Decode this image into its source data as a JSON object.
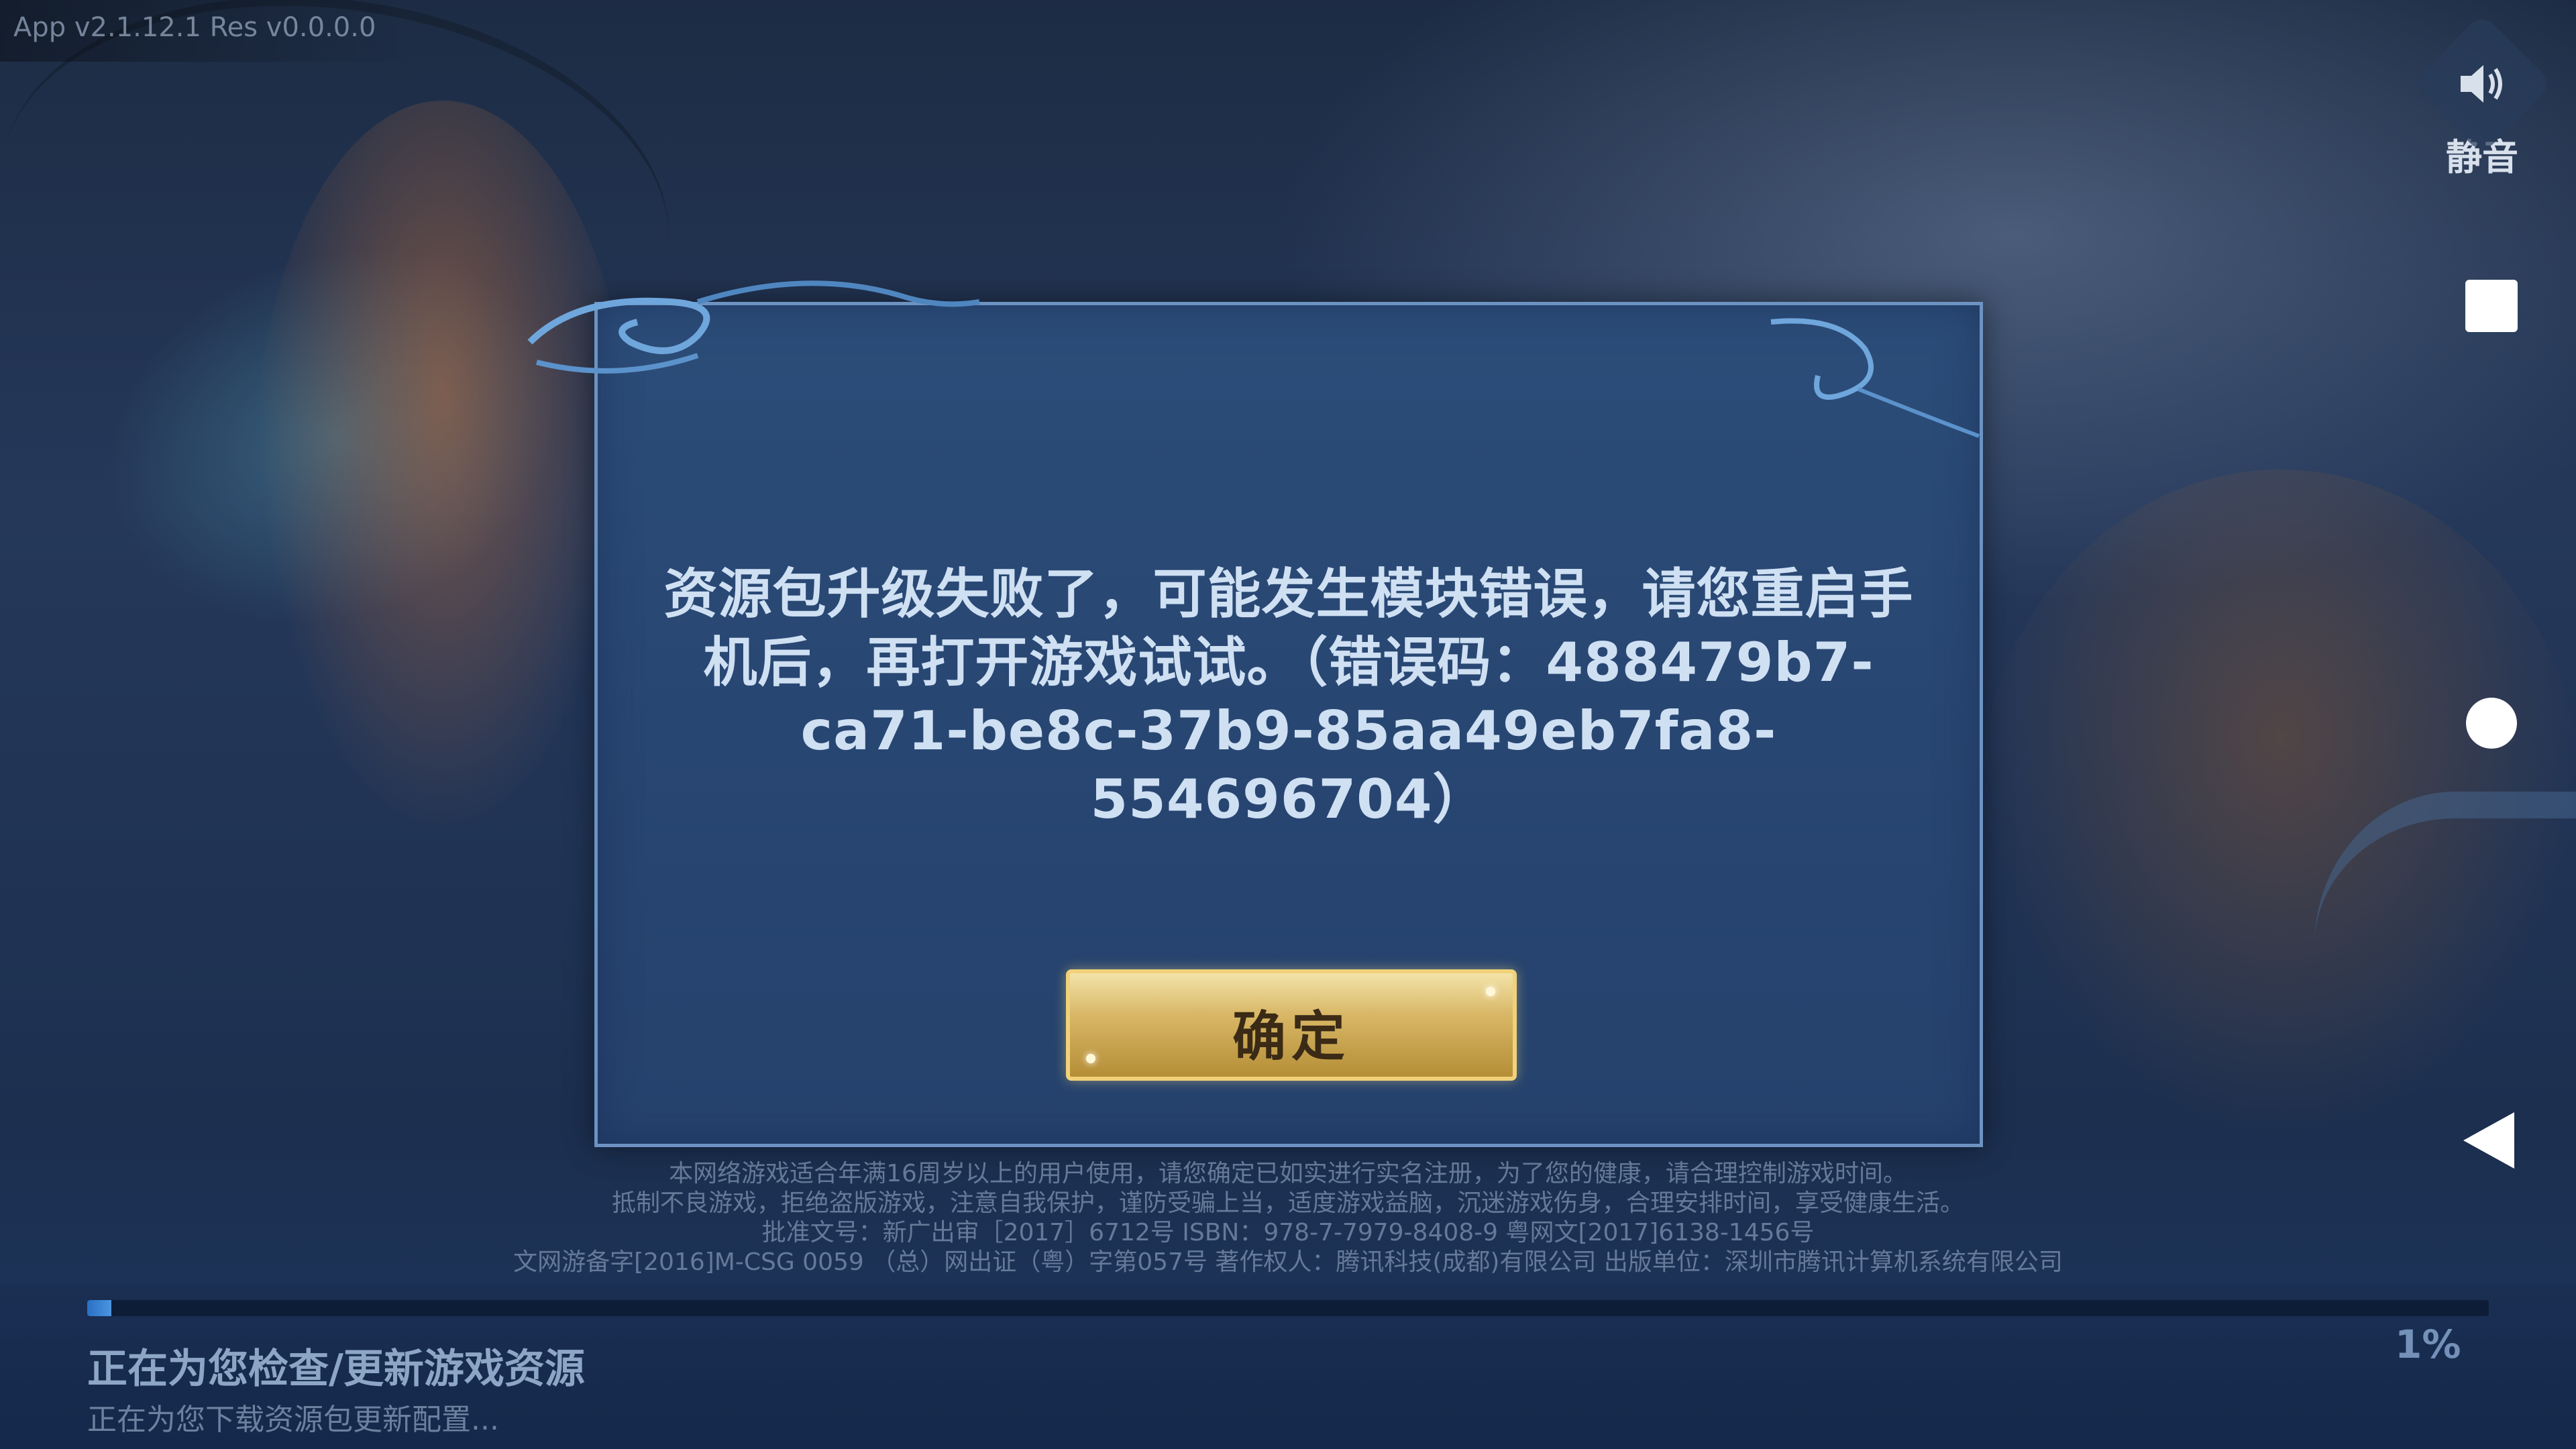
{
  "app": {
    "version_text": "App v2.1.12.1   Res v0.0.0.0"
  },
  "mute": {
    "label": "静音",
    "icon": "speaker-icon"
  },
  "android_nav": {
    "icons": [
      "recent-apps-square-icon",
      "home-circle-icon",
      "back-triangle-icon"
    ]
  },
  "dialog": {
    "message": "资源包升级失败了，可能发生模块错误，请您重启手机后，再打开游戏试试。（错误码：488479b7-ca71-be8c-37b9-85aa49eb7fa8-554696704）",
    "ok_label": "确定"
  },
  "legal": {
    "line1": "本网络游戏适合年满16周岁以上的用户使用，请您确定已如实进行实名注册，为了您的健康，请合理控制游戏时间。",
    "line2": "抵制不良游戏，拒绝盗版游戏，注意自我保护，谨防受骗上当，适度游戏益脑，沉迷游戏伤身，合理安排时间，享受健康生活。",
    "line3": "批准文号：新广出审［2017］6712号  ISBN：978-7-7979-8408-9  粤网文[2017]6138-1456号",
    "line4": "文网游备字[2016]M-CSG 0059 （总）网出证（粤）字第057号  著作权人：腾讯科技(成都)有限公司  出版单位：深圳市腾讯计算机系统有限公司"
  },
  "loading": {
    "progress": 0.01,
    "percent_text": "1%",
    "status_main": "正在为您检查/更新游戏资源",
    "status_sub": "正在为您下载资源包更新配置..."
  },
  "colors": {
    "dialog_bg": "#284672",
    "dialog_border": "#6c93c2",
    "button_gold": "#d8b766",
    "progress_blue": "#2a70c4"
  }
}
